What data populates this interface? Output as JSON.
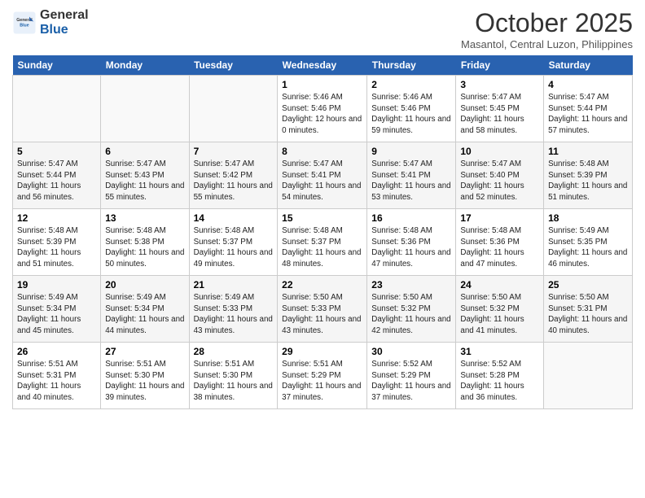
{
  "header": {
    "logo_general": "General",
    "logo_blue": "Blue",
    "month": "October 2025",
    "location": "Masantol, Central Luzon, Philippines"
  },
  "days_of_week": [
    "Sunday",
    "Monday",
    "Tuesday",
    "Wednesday",
    "Thursday",
    "Friday",
    "Saturday"
  ],
  "weeks": [
    [
      {
        "day": "",
        "sunrise": "",
        "sunset": "",
        "daylight": ""
      },
      {
        "day": "",
        "sunrise": "",
        "sunset": "",
        "daylight": ""
      },
      {
        "day": "",
        "sunrise": "",
        "sunset": "",
        "daylight": ""
      },
      {
        "day": "1",
        "sunrise": "Sunrise: 5:46 AM",
        "sunset": "Sunset: 5:46 PM",
        "daylight": "Daylight: 12 hours and 0 minutes."
      },
      {
        "day": "2",
        "sunrise": "Sunrise: 5:46 AM",
        "sunset": "Sunset: 5:46 PM",
        "daylight": "Daylight: 11 hours and 59 minutes."
      },
      {
        "day": "3",
        "sunrise": "Sunrise: 5:47 AM",
        "sunset": "Sunset: 5:45 PM",
        "daylight": "Daylight: 11 hours and 58 minutes."
      },
      {
        "day": "4",
        "sunrise": "Sunrise: 5:47 AM",
        "sunset": "Sunset: 5:44 PM",
        "daylight": "Daylight: 11 hours and 57 minutes."
      }
    ],
    [
      {
        "day": "5",
        "sunrise": "Sunrise: 5:47 AM",
        "sunset": "Sunset: 5:44 PM",
        "daylight": "Daylight: 11 hours and 56 minutes."
      },
      {
        "day": "6",
        "sunrise": "Sunrise: 5:47 AM",
        "sunset": "Sunset: 5:43 PM",
        "daylight": "Daylight: 11 hours and 55 minutes."
      },
      {
        "day": "7",
        "sunrise": "Sunrise: 5:47 AM",
        "sunset": "Sunset: 5:42 PM",
        "daylight": "Daylight: 11 hours and 55 minutes."
      },
      {
        "day": "8",
        "sunrise": "Sunrise: 5:47 AM",
        "sunset": "Sunset: 5:41 PM",
        "daylight": "Daylight: 11 hours and 54 minutes."
      },
      {
        "day": "9",
        "sunrise": "Sunrise: 5:47 AM",
        "sunset": "Sunset: 5:41 PM",
        "daylight": "Daylight: 11 hours and 53 minutes."
      },
      {
        "day": "10",
        "sunrise": "Sunrise: 5:47 AM",
        "sunset": "Sunset: 5:40 PM",
        "daylight": "Daylight: 11 hours and 52 minutes."
      },
      {
        "day": "11",
        "sunrise": "Sunrise: 5:48 AM",
        "sunset": "Sunset: 5:39 PM",
        "daylight": "Daylight: 11 hours and 51 minutes."
      }
    ],
    [
      {
        "day": "12",
        "sunrise": "Sunrise: 5:48 AM",
        "sunset": "Sunset: 5:39 PM",
        "daylight": "Daylight: 11 hours and 51 minutes."
      },
      {
        "day": "13",
        "sunrise": "Sunrise: 5:48 AM",
        "sunset": "Sunset: 5:38 PM",
        "daylight": "Daylight: 11 hours and 50 minutes."
      },
      {
        "day": "14",
        "sunrise": "Sunrise: 5:48 AM",
        "sunset": "Sunset: 5:37 PM",
        "daylight": "Daylight: 11 hours and 49 minutes."
      },
      {
        "day": "15",
        "sunrise": "Sunrise: 5:48 AM",
        "sunset": "Sunset: 5:37 PM",
        "daylight": "Daylight: 11 hours and 48 minutes."
      },
      {
        "day": "16",
        "sunrise": "Sunrise: 5:48 AM",
        "sunset": "Sunset: 5:36 PM",
        "daylight": "Daylight: 11 hours and 47 minutes."
      },
      {
        "day": "17",
        "sunrise": "Sunrise: 5:48 AM",
        "sunset": "Sunset: 5:36 PM",
        "daylight": "Daylight: 11 hours and 47 minutes."
      },
      {
        "day": "18",
        "sunrise": "Sunrise: 5:49 AM",
        "sunset": "Sunset: 5:35 PM",
        "daylight": "Daylight: 11 hours and 46 minutes."
      }
    ],
    [
      {
        "day": "19",
        "sunrise": "Sunrise: 5:49 AM",
        "sunset": "Sunset: 5:34 PM",
        "daylight": "Daylight: 11 hours and 45 minutes."
      },
      {
        "day": "20",
        "sunrise": "Sunrise: 5:49 AM",
        "sunset": "Sunset: 5:34 PM",
        "daylight": "Daylight: 11 hours and 44 minutes."
      },
      {
        "day": "21",
        "sunrise": "Sunrise: 5:49 AM",
        "sunset": "Sunset: 5:33 PM",
        "daylight": "Daylight: 11 hours and 43 minutes."
      },
      {
        "day": "22",
        "sunrise": "Sunrise: 5:50 AM",
        "sunset": "Sunset: 5:33 PM",
        "daylight": "Daylight: 11 hours and 43 minutes."
      },
      {
        "day": "23",
        "sunrise": "Sunrise: 5:50 AM",
        "sunset": "Sunset: 5:32 PM",
        "daylight": "Daylight: 11 hours and 42 minutes."
      },
      {
        "day": "24",
        "sunrise": "Sunrise: 5:50 AM",
        "sunset": "Sunset: 5:32 PM",
        "daylight": "Daylight: 11 hours and 41 minutes."
      },
      {
        "day": "25",
        "sunrise": "Sunrise: 5:50 AM",
        "sunset": "Sunset: 5:31 PM",
        "daylight": "Daylight: 11 hours and 40 minutes."
      }
    ],
    [
      {
        "day": "26",
        "sunrise": "Sunrise: 5:51 AM",
        "sunset": "Sunset: 5:31 PM",
        "daylight": "Daylight: 11 hours and 40 minutes."
      },
      {
        "day": "27",
        "sunrise": "Sunrise: 5:51 AM",
        "sunset": "Sunset: 5:30 PM",
        "daylight": "Daylight: 11 hours and 39 minutes."
      },
      {
        "day": "28",
        "sunrise": "Sunrise: 5:51 AM",
        "sunset": "Sunset: 5:30 PM",
        "daylight": "Daylight: 11 hours and 38 minutes."
      },
      {
        "day": "29",
        "sunrise": "Sunrise: 5:51 AM",
        "sunset": "Sunset: 5:29 PM",
        "daylight": "Daylight: 11 hours and 37 minutes."
      },
      {
        "day": "30",
        "sunrise": "Sunrise: 5:52 AM",
        "sunset": "Sunset: 5:29 PM",
        "daylight": "Daylight: 11 hours and 37 minutes."
      },
      {
        "day": "31",
        "sunrise": "Sunrise: 5:52 AM",
        "sunset": "Sunset: 5:28 PM",
        "daylight": "Daylight: 11 hours and 36 minutes."
      },
      {
        "day": "",
        "sunrise": "",
        "sunset": "",
        "daylight": ""
      }
    ]
  ]
}
